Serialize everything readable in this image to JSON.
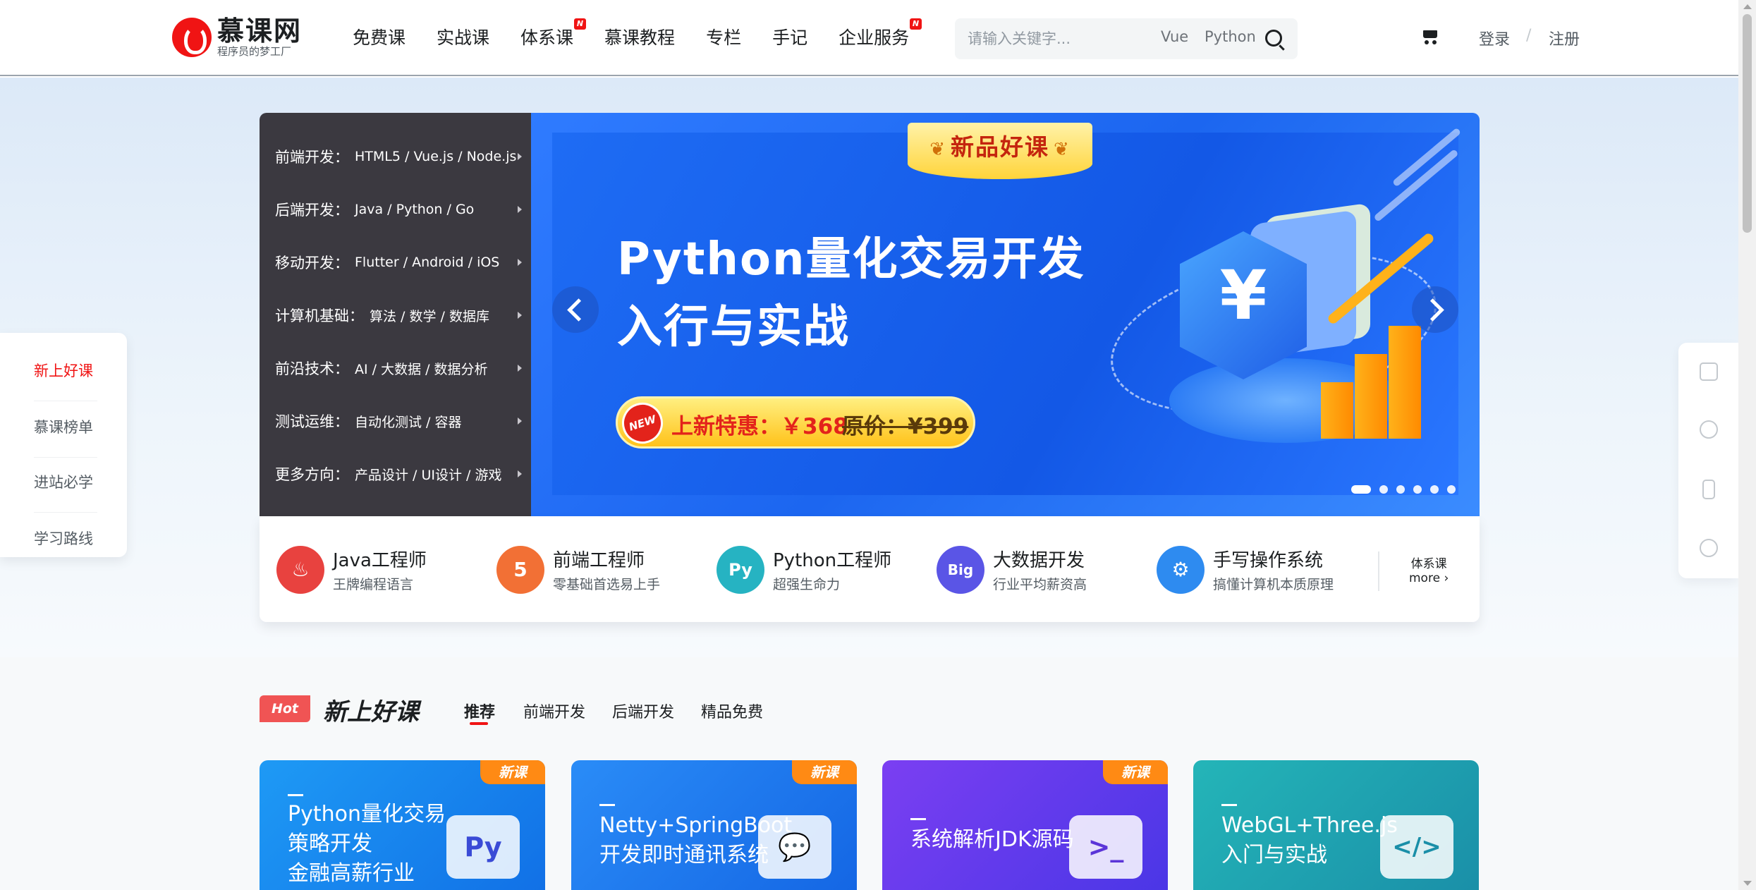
{
  "header": {
    "logo_title": "慕课网",
    "logo_sub": "程序员的梦工厂",
    "nav": [
      {
        "label": "免费课",
        "badge": ""
      },
      {
        "label": "实战课",
        "badge": ""
      },
      {
        "label": "体系课",
        "badge": "N"
      },
      {
        "label": "慕课教程",
        "badge": ""
      },
      {
        "label": "专栏",
        "badge": ""
      },
      {
        "label": "手记",
        "badge": ""
      },
      {
        "label": "企业服务",
        "badge": "N"
      }
    ],
    "search": {
      "placeholder": "请输入关键字...",
      "hot1": "Vue",
      "hot2": "Python"
    },
    "login": "登录",
    "separator": "/",
    "register": "注册"
  },
  "categories": [
    {
      "label": "前端开发：",
      "links": "HTML5 / Vue.js / Node.js"
    },
    {
      "label": "后端开发：",
      "links": "Java / Python / Go"
    },
    {
      "label": "移动开发：",
      "links": "Flutter / Android / iOS"
    },
    {
      "label": "计算机基础：",
      "links": "算法 / 数学 / 数据库"
    },
    {
      "label": "前沿技术：",
      "links": "AI / 大数据 / 数据分析"
    },
    {
      "label": "测试运维：",
      "links": "自动化测试 / 容器"
    },
    {
      "label": "更多方向：",
      "links": "产品设计 / UI设计 / 游戏"
    }
  ],
  "banner": {
    "badge": "新品好课",
    "title_line1": "Python量化交易开发",
    "title_line2": "入行与实战",
    "price_icon": "NEW",
    "price_label": "上新特惠：￥368",
    "price_orig": "原价：¥399",
    "slide_count": 6,
    "active_slide": 1
  },
  "featured": [
    {
      "title": "Java工程师",
      "sub": "王牌编程语言",
      "icon": "java-icon",
      "color": "#e8423f",
      "glyph": "♨"
    },
    {
      "title": "前端工程师",
      "sub": "零基础首选易上手",
      "icon": "html5-icon",
      "color": "#f27035",
      "glyph": "5"
    },
    {
      "title": "Python工程师",
      "sub": "超强生命力",
      "icon": "python-icon",
      "color": "#26b3c2",
      "glyph": "Py"
    },
    {
      "title": "大数据开发",
      "sub": "行业平均薪资高",
      "icon": "bigdata-icon",
      "color": "#5a55e6",
      "glyph": "Big"
    },
    {
      "title": "手写操作系统",
      "sub": "搞懂计算机本质原理",
      "icon": "os-icon",
      "color": "#2e8bf0",
      "glyph": "⚙"
    }
  ],
  "featured_more": {
    "line1": "体系课",
    "line2": "more ›"
  },
  "side_left": [
    "新上好课",
    "慕课榜单",
    "进站必学",
    "学习路线"
  ],
  "section": {
    "hot": "Hot",
    "title": "新上好课",
    "tabs": [
      "推荐",
      "前端开发",
      "后端开发",
      "精品免费"
    ]
  },
  "courses": [
    {
      "lines": [
        "Python量化交易",
        "策略开发",
        "金融高薪行业"
      ],
      "tag": "新课",
      "bg": "#1a8cf0",
      "glyph": "Py"
    },
    {
      "lines": [
        "Netty+SpringBoot",
        "开发即时通讯系统"
      ],
      "tag": "新课",
      "bg": "#1e7ef2",
      "glyph": "💬"
    },
    {
      "lines": [
        "系统解析JDK源码"
      ],
      "tag": "新课",
      "bg": "#6a3ff0",
      "glyph": ">_"
    },
    {
      "lines": [
        "WebGL+Three.js",
        "入门与实战"
      ],
      "tag": "",
      "bg": "#1fa9b3",
      "glyph": "</>"
    }
  ]
}
